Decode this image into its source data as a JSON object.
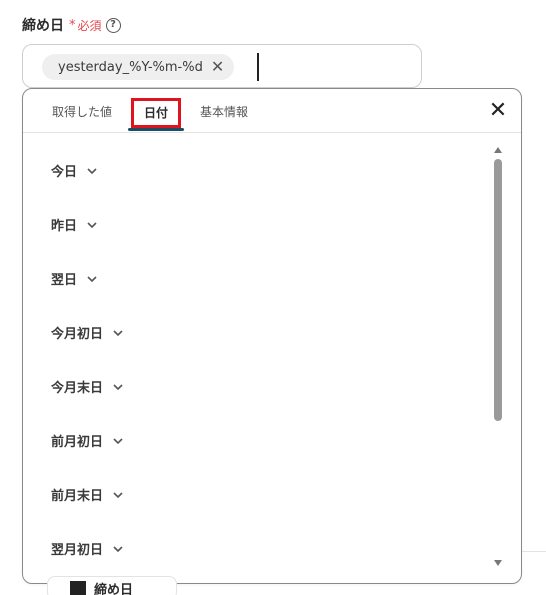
{
  "field": {
    "label": "締め日",
    "required_star": "*",
    "required_text": "必須",
    "help_icon": "?"
  },
  "input": {
    "chip_value": "yesterday_%Y-%m-%d",
    "chip_remove": "✕"
  },
  "dropdown": {
    "tabs": [
      {
        "label": "取得した値"
      },
      {
        "label": "日付"
      },
      {
        "label": "基本情報"
      }
    ],
    "active_tab": "日付",
    "close": "✕",
    "items": [
      {
        "label": "今日"
      },
      {
        "label": "昨日"
      },
      {
        "label": "翌日"
      },
      {
        "label": "今月初日"
      },
      {
        "label": "今月末日"
      },
      {
        "label": "前月初日"
      },
      {
        "label": "前月末日"
      },
      {
        "label": "翌月初日"
      }
    ]
  },
  "background": {
    "bottom_label": "締め日"
  },
  "colors": {
    "required": "#e5484d",
    "active_tab_highlight": "#e0141e",
    "active_tab_underline": "#1b4f66"
  }
}
